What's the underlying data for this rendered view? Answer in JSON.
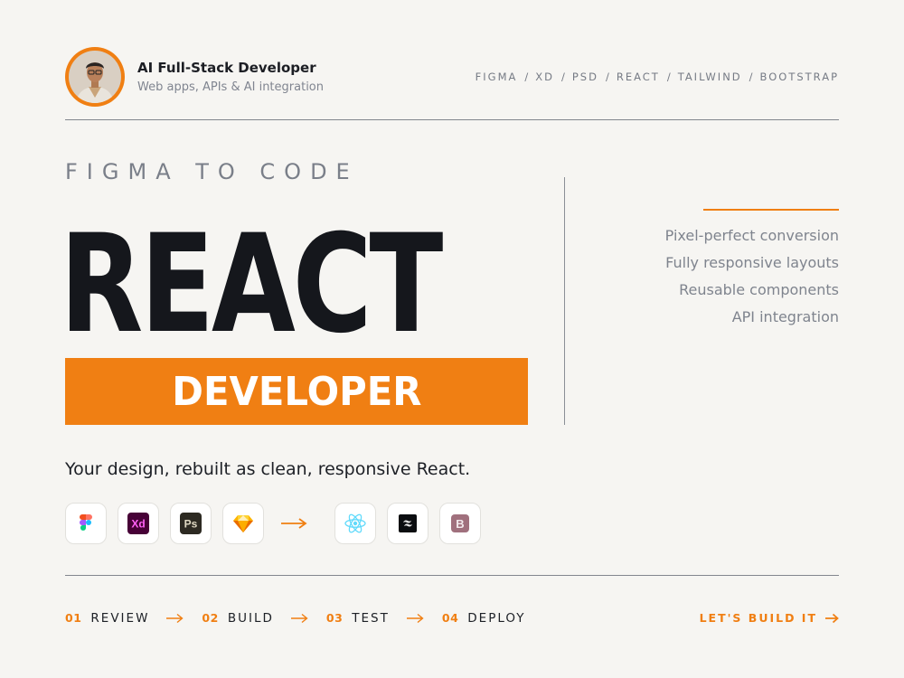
{
  "profile": {
    "name": "AI Full-Stack Developer",
    "subtitle": "Web apps, APIs & AI integration"
  },
  "tech_stack": [
    "FIGMA",
    "XD",
    "PSD",
    "REACT",
    "TAILWIND",
    "BOOTSTRAP"
  ],
  "tech_separator": "/",
  "hero": {
    "eyebrow": "FIGMA TO CODE",
    "title": "REACT",
    "badge": "DEVELOPER"
  },
  "features": [
    "Pixel-perfect conversion",
    "Fully responsive layouts",
    "Reusable components",
    "API integration"
  ],
  "tagline": "Your design, rebuilt as clean, responsive React.",
  "tools": {
    "from": [
      {
        "icon": "figma-icon"
      },
      {
        "icon": "xd-icon",
        "text": "Xd"
      },
      {
        "icon": "photoshop-icon",
        "text": "Ps"
      },
      {
        "icon": "sketch-icon"
      }
    ],
    "to": [
      {
        "icon": "react-icon"
      },
      {
        "icon": "tailwind-icon"
      },
      {
        "icon": "bootstrap-icon",
        "text": "B"
      }
    ]
  },
  "steps": [
    {
      "num": "01",
      "label": "REVIEW"
    },
    {
      "num": "02",
      "label": "BUILD"
    },
    {
      "num": "03",
      "label": "TEST"
    },
    {
      "num": "04",
      "label": "DEPLOY"
    }
  ],
  "cta": {
    "label": "LET'S BUILD IT"
  },
  "colors": {
    "accent": "#f07f13",
    "background": "#f6f5f2",
    "ink": "#15171c",
    "muted": "#7f848e"
  }
}
